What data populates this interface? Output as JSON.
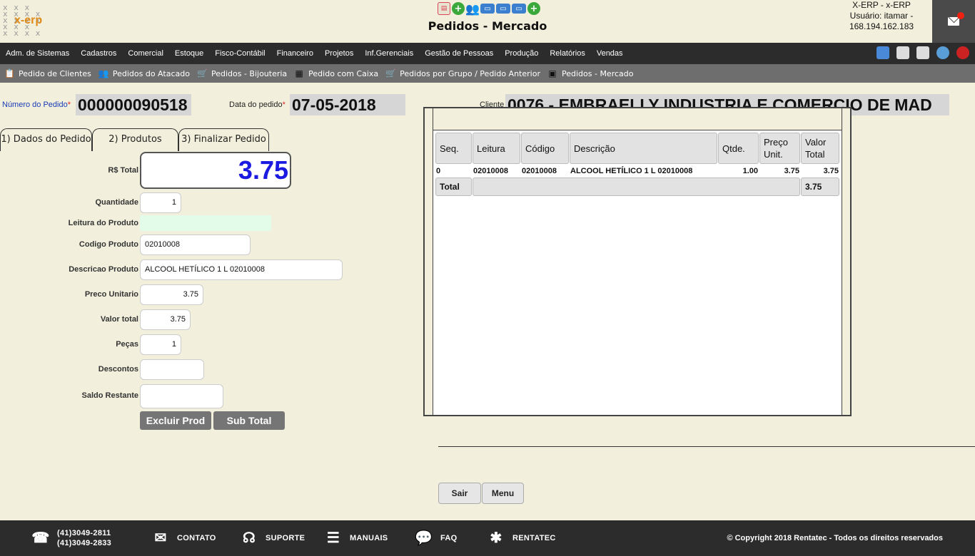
{
  "header": {
    "logo_text": "x-erp",
    "title": "Pedidos - Mercado",
    "user_line1": "X-ERP - x-ERP",
    "user_line2": "Usuário: itamar -",
    "user_line3": "168.194.162.183",
    "quick_icons": [
      "document-icon",
      "add-icon",
      "users-icon",
      "card-icon",
      "card-icon",
      "card-icon",
      "add-icon"
    ]
  },
  "main_menu": {
    "items": [
      "Adm. de Sistemas",
      "Cadastros",
      "Comercial",
      "Estoque",
      "Fisco-Contábil",
      "Financeiro",
      "Projetos",
      "Inf.Gerenciais",
      "Gestão de Pessoas",
      "Produção",
      "Relatórios",
      "Vendas"
    ],
    "right_icons": [
      "home-icon",
      "document-icon",
      "page-icon",
      "globe-icon",
      "power-icon"
    ]
  },
  "sub_menu": {
    "items": [
      {
        "label": "Pedido de Clientes",
        "icon": "clipboard-icon"
      },
      {
        "label": "Pedidos do Atacado",
        "icon": "people-icon"
      },
      {
        "label": "Pedidos - Bijouteria",
        "icon": "cart-icon"
      },
      {
        "label": "Pedido com Caixa",
        "icon": "register-icon"
      },
      {
        "label": "Pedidos por Grupo / Pedido Anterior",
        "icon": "cart-icon"
      },
      {
        "label": "Pedidos - Mercado",
        "icon": "store-icon"
      }
    ]
  },
  "order": {
    "numero_label": "Número do Pedido",
    "numero_value": "000000090518",
    "data_label": "Data do pedido",
    "data_value": "07-05-2018",
    "cliente_label": "Cliente",
    "cliente_value": "0076 - EMBRAELLY INDUSTRIA E COMERCIO DE MAD",
    "required_mark": "*"
  },
  "tabs": [
    {
      "label": "1) Dados do Pedido"
    },
    {
      "label": "2) Produtos"
    },
    {
      "label": "3) Finalizar Pedido"
    }
  ],
  "form": {
    "total_label": "R$ Total",
    "total_value": "3.75",
    "quantidade_label": "Quantidade",
    "quantidade_value": "1",
    "leitura_label": "Leitura do Produto",
    "leitura_value": "",
    "codigo_label": "Codigo Produto",
    "codigo_value": "02010008",
    "descricao_label": "Descricao Produto",
    "descricao_value": "ALCOOL HETÍLICO 1 L 02010008",
    "preco_label": "Preco Unitario",
    "preco_value": "3.75",
    "valor_label": "Valor total",
    "valor_value": "3.75",
    "pecas_label": "Peças",
    "pecas_value": "1",
    "descontos_label": "Descontos",
    "descontos_value": "",
    "saldo_label": "Saldo Restante",
    "saldo_value": "",
    "excluir_label": "Excluir Prod",
    "subtotal_label": "Sub Total"
  },
  "grid": {
    "headers": [
      "Seq.",
      "Leitura",
      "Código",
      "Descrição",
      "Qtde.",
      "Preço Unit.",
      "Valor Total"
    ],
    "rows": [
      [
        "0",
        "02010008",
        "02010008",
        "ALCOOL HETÍLICO 1 L 02010008",
        "1.00",
        "3.75",
        "3.75"
      ]
    ],
    "total_label": "Total",
    "total_value": "3.75"
  },
  "actions": {
    "sair_label": "Sair",
    "menu_label": "Menu"
  },
  "footer": {
    "phone1": "(41)3049-2811",
    "phone2": "(41)3049-2833",
    "contato": "CONTATO",
    "suporte": "SUPORTE",
    "manuais": "MANUAIS",
    "faq": "FAQ",
    "rentatec": "RENTATEC",
    "copyright": "© Copyright 2018 Rentatec - Todos os direitos reservados"
  }
}
